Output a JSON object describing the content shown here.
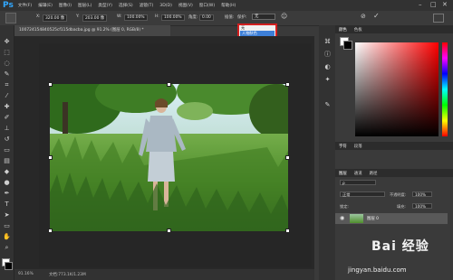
{
  "app": {
    "logo": "Ps"
  },
  "menu": [
    "文件(F)",
    "编辑(E)",
    "图像(I)",
    "图层(L)",
    "类型(Y)",
    "选择(S)",
    "滤镜(T)",
    "3D(D)",
    "视图(V)",
    "窗口(W)",
    "帮助(H)"
  ],
  "options": {
    "x_label": "X:",
    "x_value": "320.00 像",
    "y_label": "Y:",
    "y_value": "203.00 像",
    "w_label": "W:",
    "w_value": "100.00%",
    "h_label": "H:",
    "h_value": "100.00%",
    "angle_label": "角度:",
    "angle_value": "0.00",
    "h2_label": "H:",
    "h2_value": "0.00",
    "v_label": "V:",
    "v_value": "0.00",
    "interp_label": "插值:",
    "interp_value": "两次立方",
    "warp_label": "保护:",
    "warp_value": "无"
  },
  "dropdown_menu": {
    "option_none": "无",
    "option_selected": "人物肤色"
  },
  "document": {
    "tab_title": "100724154840525cf115dbacba.jpg @ 91.2% (图层 0, RGB/8) *",
    "zoom": "91.16%",
    "doc_size": "文档:773.1K/1.23M"
  },
  "color_panel": {
    "tabs": [
      "颜色",
      "色板"
    ]
  },
  "char_panel": {
    "tabs": [
      "字符",
      "段落"
    ]
  },
  "layers_panel": {
    "tabs": [
      "图层",
      "通道",
      "路径"
    ],
    "blend_mode": "正常",
    "opacity_label": "不透明度:",
    "opacity_value": "100%",
    "lock_label": "锁定:",
    "fill_label": "填充:",
    "fill_value": "100%",
    "layer_name": "图层 0"
  },
  "watermark": {
    "title": "Bai 经验",
    "url": "jingyan.baidu.com"
  },
  "colors": {
    "accent": "#31a8ff",
    "highlight": "#d21f1f",
    "selection": "#3d7fd8"
  }
}
